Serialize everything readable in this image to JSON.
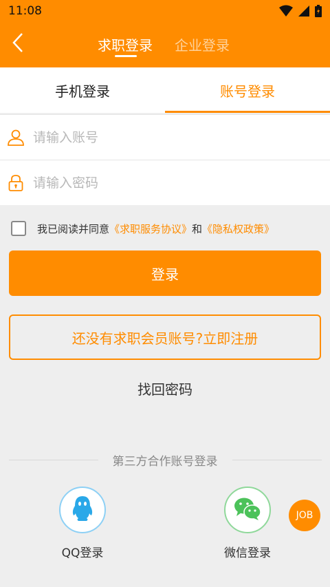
{
  "status_bar": {
    "time": "11:08"
  },
  "header": {
    "tab_jobseeker": "求职登录",
    "tab_company": "企业登录"
  },
  "login_tabs": {
    "phone": "手机登录",
    "account": "账号登录"
  },
  "fields": {
    "account_placeholder": "请输入账号",
    "password_placeholder": "请输入密码"
  },
  "agreement": {
    "prefix": "我已阅读并同意",
    "service_link": "《求职服务协议》",
    "and": "和",
    "privacy_link": "《隐私权政策》"
  },
  "buttons": {
    "login": "登录",
    "register": "还没有求职会员账号?立即注册",
    "forgot": "找回密码"
  },
  "third_party": {
    "label": "第三方合作账号登录",
    "qq": "QQ登录",
    "wechat": "微信登录"
  },
  "badge": {
    "job": "JOB"
  },
  "colors": {
    "accent": "#ff8c00",
    "qq_blue": "#2aa8e8",
    "wechat_green": "#4cc25a"
  }
}
